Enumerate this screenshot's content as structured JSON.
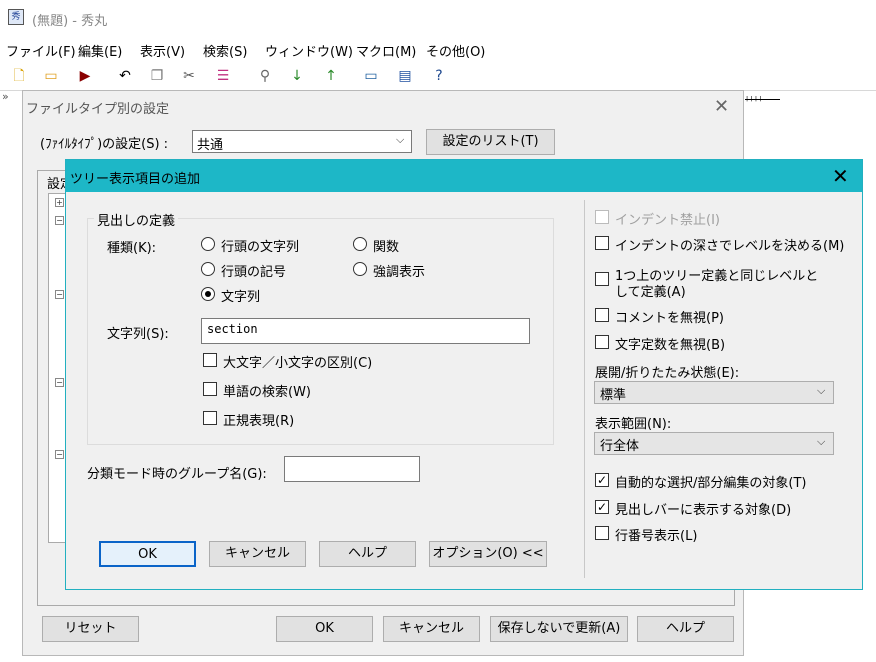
{
  "window": {
    "title": "(無題) - 秀丸",
    "menu": [
      "ファイル(F)",
      "編集(E)",
      "表示(V)",
      "検索(S)",
      "ウィンドウ(W)",
      "マクロ(M)",
      "その他(O)"
    ]
  },
  "outer_dialog": {
    "title": "ファイルタイプ別の設定",
    "filetype_label": "(ﾌｧｲﾙﾀｲﾌﾟ)の設定(S) :",
    "filetype_value": "共通",
    "list_button": "設定のリスト(T)",
    "group_label": "設定",
    "buttons": {
      "reset": "リセット",
      "ok": "OK",
      "cancel": "キャンセル",
      "update_no_save": "保存しないで更新(A)",
      "help": "ヘルプ"
    }
  },
  "inner_dialog": {
    "title": "ツリー表示項目の追加",
    "heading_group": "見出しの定義",
    "kind_label": "種類(K):",
    "radios": [
      {
        "label": "行頭の文字列",
        "checked": false
      },
      {
        "label": "関数",
        "checked": false
      },
      {
        "label": "行頭の記号",
        "checked": false
      },
      {
        "label": "強調表示",
        "checked": false
      },
      {
        "label": "文字列",
        "checked": true
      }
    ],
    "string_label": "文字列(S):",
    "string_value": "section",
    "left_checks": [
      {
        "label": "大文字／小文字の区別(C)",
        "checked": false
      },
      {
        "label": "単語の検索(W)",
        "checked": false
      },
      {
        "label": "正規表現(R)",
        "checked": false
      }
    ],
    "group_name_label": "分類モード時のグループ名(G):",
    "group_name_value": "",
    "buttons": {
      "ok": "OK",
      "cancel": "キャンセル",
      "help": "ヘルプ",
      "options": "オプション(O) <<"
    },
    "right_checks": [
      {
        "label": "インデント禁止(I)",
        "checked": false,
        "disabled": true
      },
      {
        "label": "インデントの深さでレベルを決める(M)",
        "checked": false,
        "disabled": false
      },
      {
        "label": "1つ上のツリー定義と同じレベルと",
        "label2": "して定義(A)",
        "checked": false,
        "disabled": false
      },
      {
        "label": "コメントを無視(P)",
        "checked": false,
        "disabled": false
      },
      {
        "label": "文字定数を無視(B)",
        "checked": false,
        "disabled": false
      }
    ],
    "expand_label": "展開/折りたたみ状態(E):",
    "expand_value": "標準",
    "range_label": "表示範囲(N):",
    "range_value": "行全体",
    "bottom_checks": [
      {
        "label": "自動的な選択/部分編集の対象(T)",
        "checked": true
      },
      {
        "label": "見出しバーに表示する対象(D)",
        "checked": true
      },
      {
        "label": "行番号表示(L)",
        "checked": false
      }
    ]
  },
  "icons": {
    "check_glyph": "✓",
    "close_glyph": "✕",
    "dropdown_glyph": "⌵",
    "expand_glyph": "+",
    "collapse_glyph": "−",
    "overflow_glyph": "»"
  }
}
